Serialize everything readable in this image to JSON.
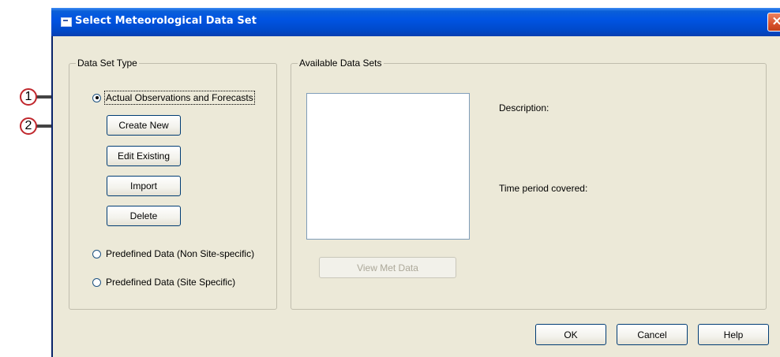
{
  "dialog": {
    "title": "Select Meteorological Data Set",
    "icon": "app-window-icon",
    "close_glyph": "✕"
  },
  "data_set_type": {
    "legend": "Data Set Type",
    "options": [
      {
        "label": "Actual Observations and Forecasts",
        "checked": true
      },
      {
        "label": "Predefined Data (Non Site-specific)",
        "checked": false
      },
      {
        "label": "Predefined Data (Site Specific)",
        "checked": false
      }
    ],
    "buttons": {
      "create_new": "Create New",
      "edit_existing": "Edit Existing",
      "import": "Import",
      "delete": "Delete"
    }
  },
  "available": {
    "legend": "Available Data Sets",
    "description_label": "Description:",
    "time_period_label": "Time period covered:",
    "view_met_data": "View Met Data"
  },
  "footer": {
    "ok": "OK",
    "cancel": "Cancel",
    "help": "Help"
  },
  "callouts": [
    "1",
    "2"
  ],
  "colors": {
    "titlebar": "#0054e3",
    "dialog_bg": "#ece9d8",
    "callout_ring": "#c0272d",
    "close_button": "#d8512c"
  }
}
